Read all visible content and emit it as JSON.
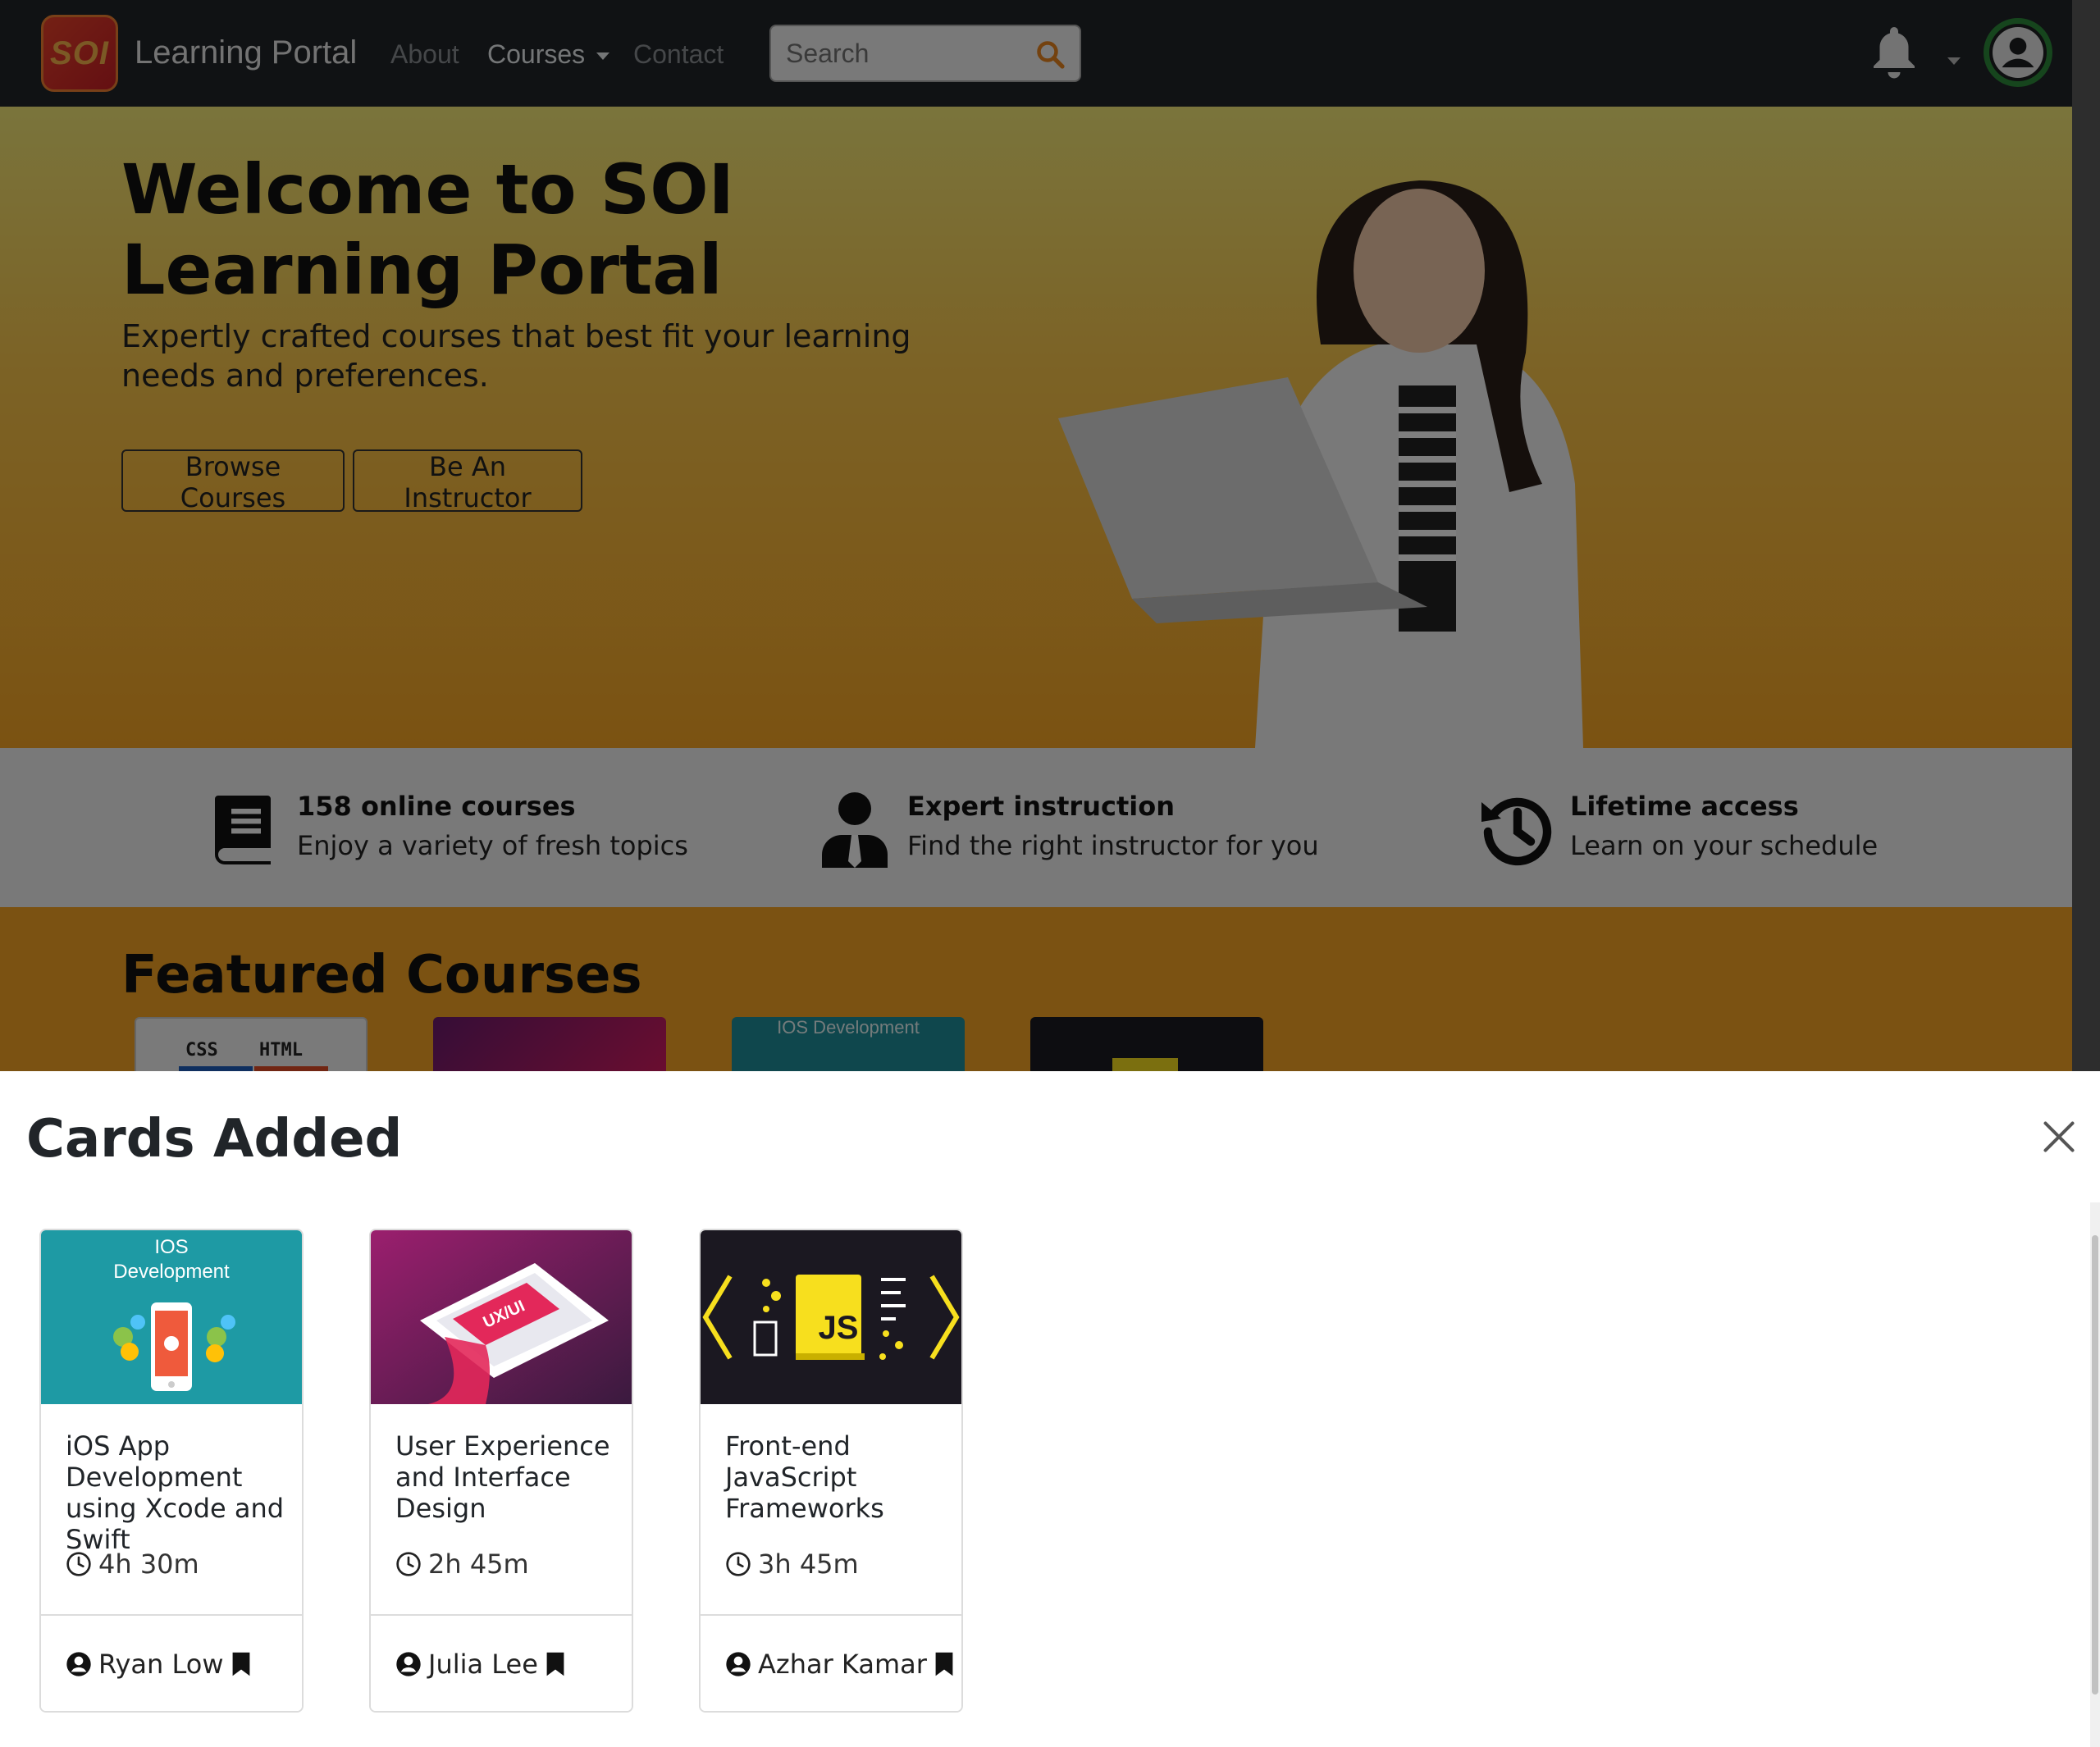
{
  "navbar": {
    "logo_text": "SOI",
    "brand": "Learning Portal",
    "links": [
      {
        "label": "About"
      },
      {
        "label": "Courses"
      },
      {
        "label": "Contact"
      }
    ],
    "search_placeholder": "Search"
  },
  "hero": {
    "title": "Welcome to SOI Learning Portal",
    "subtitle": "Expertly crafted courses that best fit your learning needs and preferences.",
    "buttons": [
      "Browse Courses",
      "Be An Instructor"
    ]
  },
  "features": [
    {
      "icon": "book-icon",
      "title": "158 online courses",
      "desc": "Enjoy a variety of fresh topics"
    },
    {
      "icon": "instructor-icon",
      "title": "Expert instruction",
      "desc": "Find the right instructor for you"
    },
    {
      "icon": "history-icon",
      "title": "Lifetime access",
      "desc": "Learn on your schedule"
    }
  ],
  "featured": {
    "title": "Featured Courses",
    "thumb_ios_label": "IOS Development",
    "thumb_css_label": "CSS",
    "thumb_html_label": "HTML"
  },
  "panel": {
    "title": "Cards Added",
    "cards": [
      {
        "title": "iOS App Development using Xcode and Swift",
        "duration": "4h 30m",
        "instructor": "Ryan Low",
        "image_label_1": "IOS",
        "image_label_2": "Development"
      },
      {
        "title": "User Experience and Interface Design",
        "duration": "2h 45m",
        "instructor": "Julia Lee",
        "image_label": "UX/UI"
      },
      {
        "title": "Front-end JavaScript Frameworks",
        "duration": "3h 45m",
        "instructor": "Azhar Kamar",
        "image_label": "JS"
      }
    ]
  },
  "colors": {
    "navbar": "#212529",
    "hero_top": "#f5e978",
    "hero_bottom": "#f7a524",
    "accent_green": "#2d8a3a",
    "search_icon": "#e8841f"
  }
}
